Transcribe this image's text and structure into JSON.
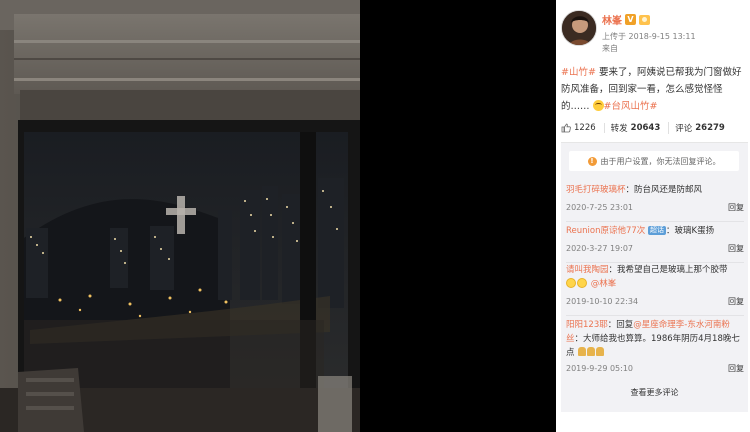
{
  "post": {
    "author": "林峯",
    "verified_mark": "V",
    "upload_time": "上传于 2018-9-15 13:11",
    "source_prefix": "来自",
    "text_tag1": "#山竹#",
    "text_body": " 要来了，阿姨说已帮我为门窗做好防风准备，回到家一看，怎么感觉怪怪的……",
    "text_tag2": "#台风山竹#",
    "likes": "1226",
    "repost_label": "转发",
    "reposts": "20643",
    "comment_label": "评论",
    "comments": "26279"
  },
  "comments_section": {
    "notice": "由于用户设置，你无法回复评论。",
    "reply_label": "回复",
    "more_label": "查看更多评论",
    "items": [
      {
        "name": "羽毛打碎玻璃杯",
        "text": "：防台风还是防邮风",
        "time": "2020-7-25 23:01"
      },
      {
        "name": "Reunion原谅他77次",
        "badge": "超话",
        "text": "：玻璃K蛋扬",
        "time": "2020-3-27 19:07"
      },
      {
        "name": "请叫我陶园",
        "text": "：我希望自己是玻璃上那个胶带",
        "mention": "@林峯",
        "time": "2019-10-10 22:34"
      },
      {
        "name": "阳阳123耶",
        "text_prefix": "：回复",
        "mention": "@星座命理李-东水河南粉丝",
        "text": "：大师给我也算算。1986年阴历4月18晚七点",
        "time": "2019-9-29 05:10"
      }
    ]
  }
}
